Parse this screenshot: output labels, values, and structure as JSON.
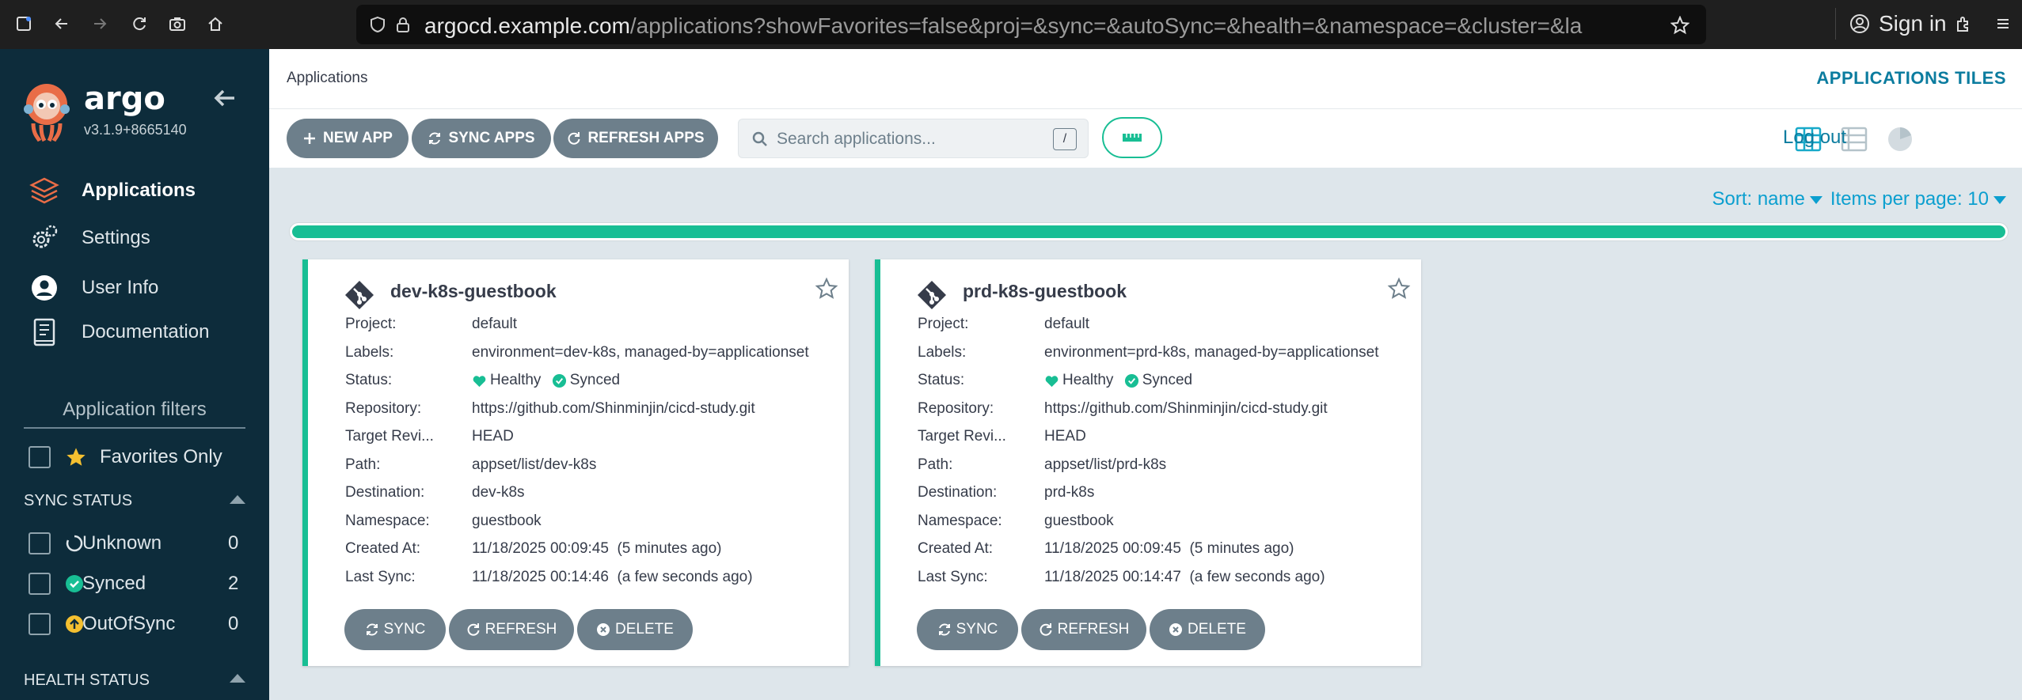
{
  "browser": {
    "url_host": "argocd.example.com",
    "url_path": "/applications?showFavorites=false&proj=&sync=&autoSync=&health=&namespace=&cluster=&la",
    "url_prefix": "",
    "sign_in": "Sign in"
  },
  "sidebar": {
    "brand": "argo",
    "version": "v3.1.9+8665140",
    "nav": [
      {
        "label": "Applications",
        "icon": "layers-icon"
      },
      {
        "label": "Settings",
        "icon": "gears-icon"
      },
      {
        "label": "User Info",
        "icon": "user-circle-icon"
      },
      {
        "label": "Documentation",
        "icon": "book-icon"
      }
    ],
    "filters_title": "Application filters",
    "favorites_label": "Favorites Only",
    "sync_status_title": "SYNC STATUS",
    "sync_status": [
      {
        "label": "Unknown",
        "count": "0"
      },
      {
        "label": "Synced",
        "count": "2"
      },
      {
        "label": "OutOfSync",
        "count": "0"
      }
    ],
    "health_status_title": "HEALTH STATUS"
  },
  "header": {
    "breadcrumb": "Applications",
    "view_title": "APPLICATIONS TILES"
  },
  "toolbar": {
    "new_app": "NEW APP",
    "sync_apps": "SYNC APPS",
    "refresh_apps": "REFRESH APPS",
    "search_placeholder": "Search applications...",
    "search_shortcut": "/",
    "logout": "Log out"
  },
  "sort": {
    "sort_label": "Sort: name",
    "items_label": "Items per page: 10"
  },
  "colors": {
    "accent": "#18be94",
    "link": "#0b9fcf",
    "sidebar_bg": "#0d2c3b",
    "button_bg": "#6d7f8b"
  },
  "labels": {
    "project": "Project:",
    "labels": "Labels:",
    "status": "Status:",
    "repository": "Repository:",
    "target_revision": "Target Revi...",
    "path": "Path:",
    "destination": "Destination:",
    "namespace": "Namespace:",
    "created_at": "Created At:",
    "last_sync": "Last Sync:",
    "healthy": "Healthy",
    "synced": "Synced",
    "sync_btn": "SYNC",
    "refresh_btn": "REFRESH",
    "delete_btn": "DELETE"
  },
  "apps": [
    {
      "name": "dev-k8s-guestbook",
      "project": "default",
      "labels": "environment=dev-k8s, managed-by=applicationset",
      "repository": "https://github.com/Shinminjin/cicd-study.git",
      "target_revision": "HEAD",
      "path": "appset/list/dev-k8s",
      "destination": "dev-k8s",
      "namespace": "guestbook",
      "created_at": "11/18/2025 00:09:45  (5 minutes ago)",
      "last_sync": "11/18/2025 00:14:46  (a few seconds ago)"
    },
    {
      "name": "prd-k8s-guestbook",
      "project": "default",
      "labels": "environment=prd-k8s, managed-by=applicationset",
      "repository": "https://github.com/Shinminjin/cicd-study.git",
      "target_revision": "HEAD",
      "path": "appset/list/prd-k8s",
      "destination": "prd-k8s",
      "namespace": "guestbook",
      "created_at": "11/18/2025 00:09:45  (5 minutes ago)",
      "last_sync": "11/18/2025 00:14:47  (a few seconds ago)"
    }
  ]
}
